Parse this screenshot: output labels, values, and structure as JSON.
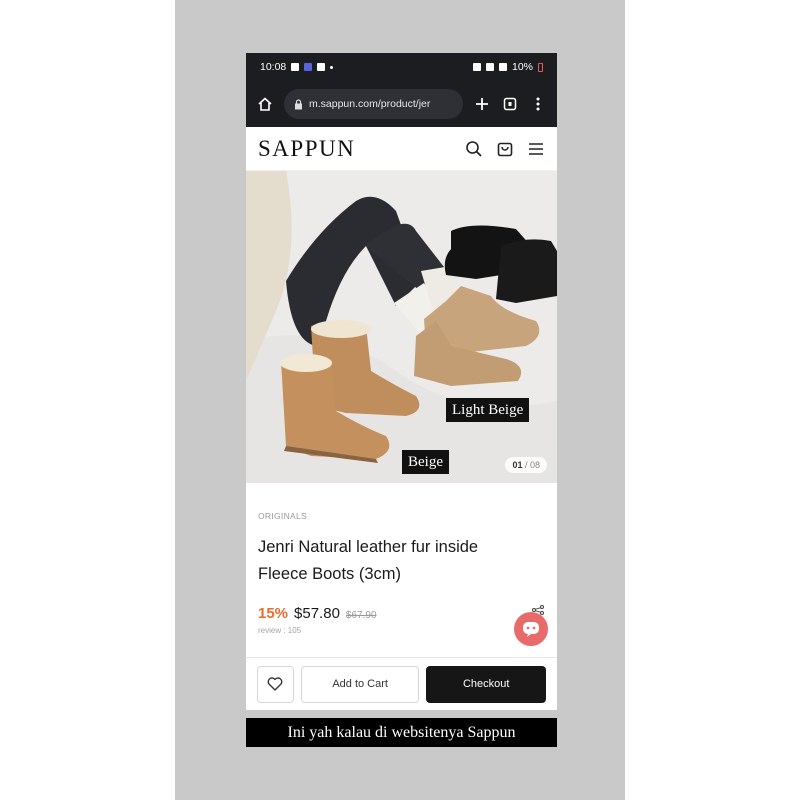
{
  "status_bar": {
    "time": "10:08",
    "battery": "10%"
  },
  "browser": {
    "url": "m.sappun.com/product/jer"
  },
  "site": {
    "logo": "SAPPUN"
  },
  "product": {
    "image_tags": [
      "Light Beige",
      "Beige"
    ],
    "image_counter_current": "01",
    "image_counter_total": "08",
    "brand": "ORIGINALS",
    "name_line1": "Jenri Natural leather fur inside",
    "name_line2": "Fleece Boots (3cm)",
    "discount": "15%",
    "price": "$57.80",
    "old_price": "$67.90",
    "review": "review : 105"
  },
  "actions": {
    "add_to_cart": "Add to Cart",
    "checkout": "Checkout"
  },
  "caption": "Ini yah kalau di websitenya Sappun",
  "colors": {
    "accent_discount": "#ee6a2c",
    "chat_button": "#e86a6a",
    "checkout_bg": "#161616"
  },
  "icons": [
    "home-icon",
    "lock-icon",
    "plus-icon",
    "tabs-icon",
    "more-icon",
    "search-icon",
    "cart-icon",
    "menu-icon",
    "heart-icon",
    "chat-icon",
    "share-icon"
  ]
}
